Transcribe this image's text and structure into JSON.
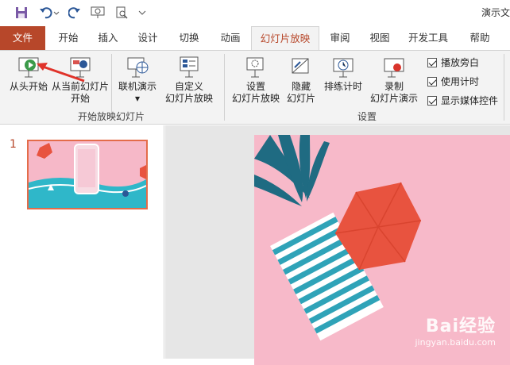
{
  "window": {
    "title": "演示文"
  },
  "qat": {
    "save": "save-icon",
    "undo": "undo-icon",
    "redo": "redo-icon"
  },
  "tabs": [
    {
      "label": "文件"
    },
    {
      "label": "开始"
    },
    {
      "label": "插入"
    },
    {
      "label": "设计"
    },
    {
      "label": "切换"
    },
    {
      "label": "动画"
    },
    {
      "label": "幻灯片放映"
    },
    {
      "label": "审阅"
    },
    {
      "label": "视图"
    },
    {
      "label": "开发工具"
    },
    {
      "label": "帮助"
    }
  ],
  "ribbon": {
    "from_beginning": "从头开始",
    "from_current_1": "从当前幻灯片",
    "from_current_2": "开始",
    "online_present": "联机演示",
    "custom_1": "自定义",
    "custom_2": "幻灯片放映",
    "group_start": "开始放映幻灯片",
    "setup_1": "设置",
    "setup_2": "幻灯片放映",
    "hide_1": "隐藏",
    "hide_2": "幻灯片",
    "rehearse": "排练计时",
    "record_1": "录制",
    "record_2": "幻灯片演示",
    "group_setup": "设置",
    "chk_narration": "播放旁白",
    "chk_timings": "使用计时",
    "chk_media": "显示媒体控件"
  },
  "thumbs": {
    "number": "1"
  },
  "watermark": {
    "brand": "Bai经验",
    "sub": "jingyan.baidu.com"
  },
  "colors": {
    "accent": "#b7472a",
    "slide_bg": "#f7b9c9",
    "hexagon": "#e8533f",
    "stripe": "#2fa3b8"
  }
}
